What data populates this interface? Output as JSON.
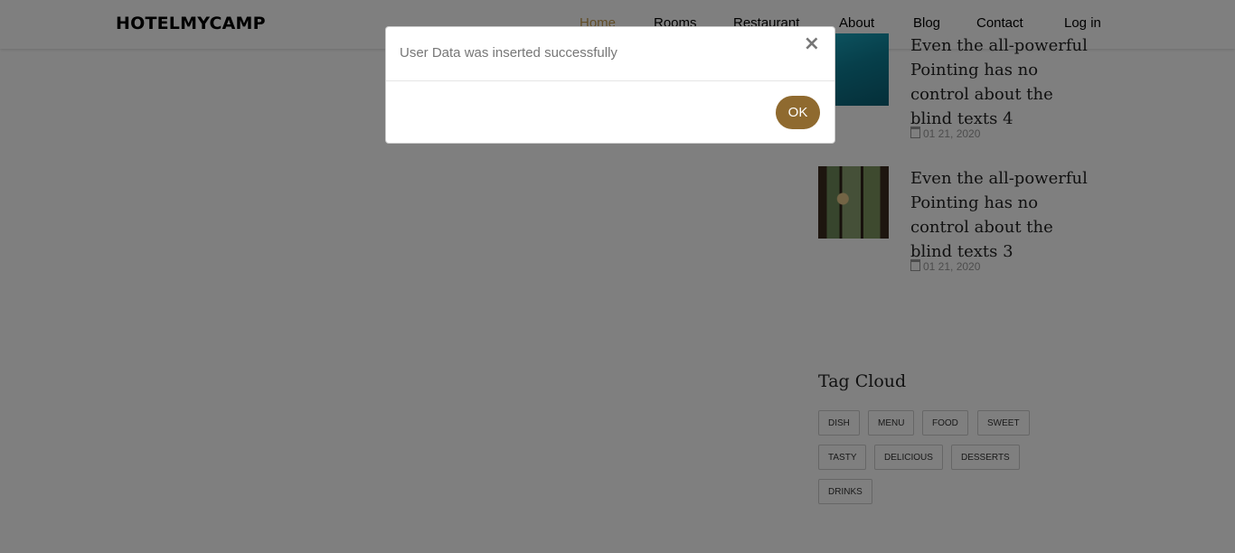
{
  "navbar": {
    "brand": "HOTELMYCAMP",
    "links": [
      "Home",
      "Rooms",
      "Restaurant",
      "About",
      "Blog",
      "Contact",
      "Log in"
    ],
    "active_color": "#c29b4f"
  },
  "sidebar": {
    "posts": [
      {
        "title": "Even the all-powerful Pointing has no control about the blind texts 4",
        "date": "01 21, 2020"
      },
      {
        "title": "Even the all-powerful Pointing has no control about the blind texts 3",
        "date": "01 21, 2020"
      }
    ],
    "tag_cloud": {
      "heading": "Tag Cloud",
      "tags": [
        "DISH",
        "MENU",
        "FOOD",
        "SWEET",
        "TASTY",
        "DELICIOUS",
        "DESSERTS",
        "DRINKS"
      ]
    }
  },
  "modal": {
    "message": "User Data was inserted successfully",
    "close_symbol": "×",
    "ok_label": "OK",
    "button_color": "#8f6a2f"
  }
}
